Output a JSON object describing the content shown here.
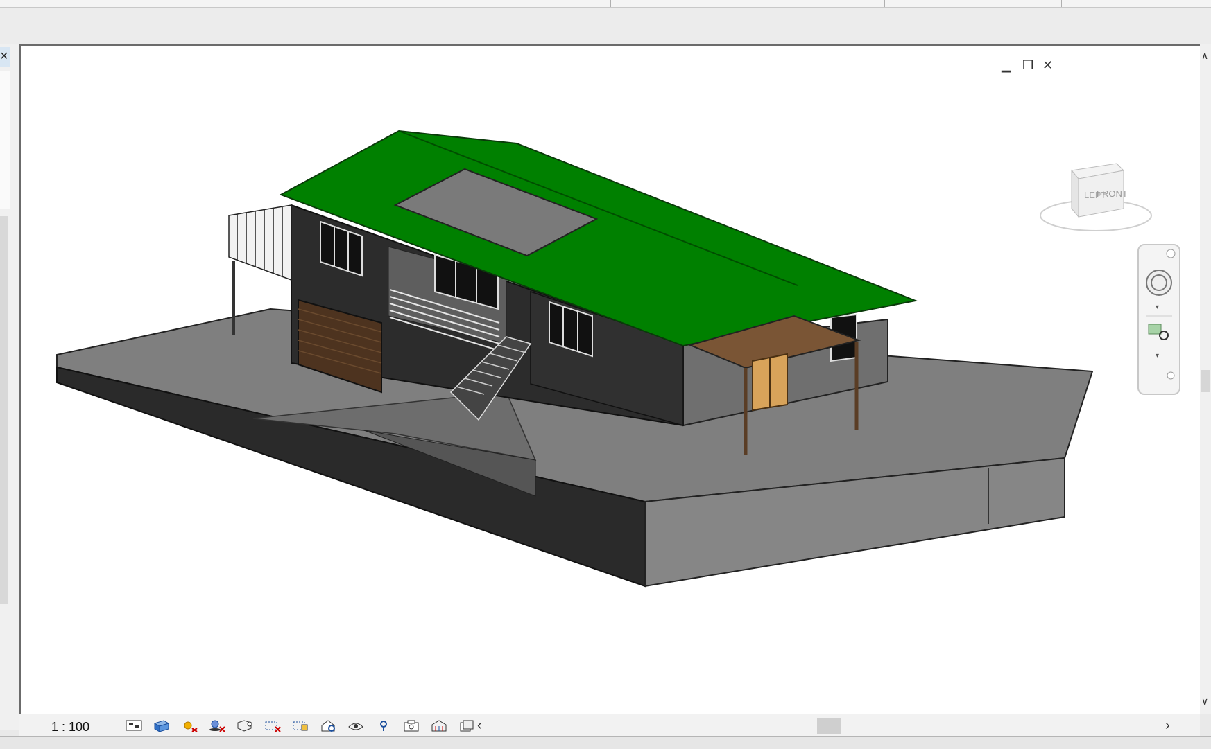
{
  "viewport": {
    "scale": "1 : 100",
    "viewcube": {
      "left_face": "LEFT",
      "front_face": "FRONT"
    }
  },
  "window_controls": [
    "minimize-icon",
    "restore-icon",
    "close-icon"
  ],
  "view_control_icons": [
    "detail-level-icon",
    "visual-style-icon",
    "sun-path-icon",
    "shadows-icon",
    "crop-view-icon",
    "show-crop-region-icon",
    "unlock-3d-view-icon",
    "temporary-hide-isolate-icon",
    "reveal-hidden-elements-icon",
    "worksharing-display-icon",
    "highlight-icon",
    "analytical-model-icon",
    "temporary-view-properties-icon",
    "reveal-constraints-icon"
  ],
  "colors": {
    "roof": "#008000",
    "walls": "#2b2b2b",
    "slab": "#808080",
    "garage_door": "#5a3d25",
    "pergola": "#7a5535",
    "doors": "#d8a35a"
  }
}
